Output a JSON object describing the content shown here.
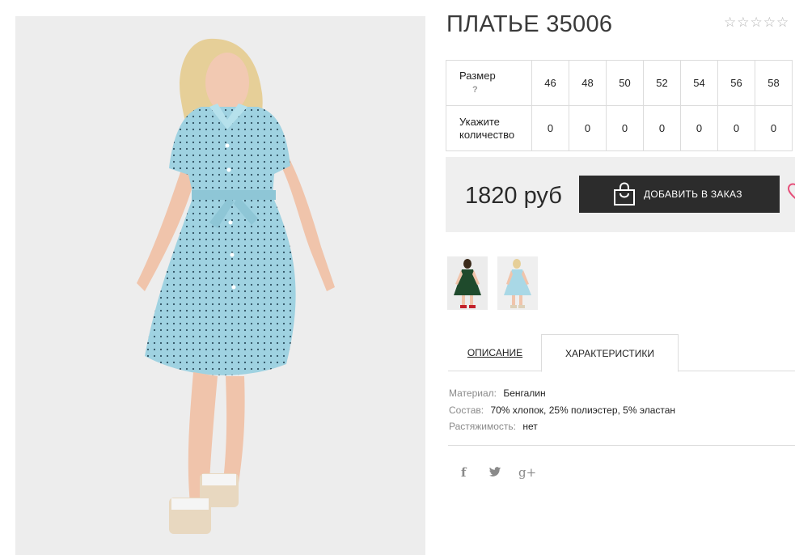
{
  "product": {
    "title": "ПЛАТЬЕ 35006",
    "rating_stars": [
      "☆",
      "☆",
      "☆",
      "☆",
      "☆"
    ]
  },
  "sizes_table": {
    "size_label": "Размер",
    "help_mark": "?",
    "qty_label": "Укажите количество",
    "sizes": [
      "46",
      "48",
      "50",
      "52",
      "54",
      "56",
      "58"
    ],
    "quantities": [
      "0",
      "0",
      "0",
      "0",
      "0",
      "0",
      "0"
    ]
  },
  "buy": {
    "price": "1820 руб",
    "add_label": "ДОБАВИТЬ В ЗАКАЗ",
    "icons": [
      "shopping-bag-icon",
      "heart-icon"
    ]
  },
  "tabs": {
    "description": "ОПИСАНИЕ",
    "characteristics": "ХАРАКТЕРИСТИКИ"
  },
  "specs": [
    {
      "key": "Материал:",
      "value": "Бенгалин"
    },
    {
      "key": "Состав:",
      "value": "70% хлопок, 25% полиэстер, 5% эластан"
    },
    {
      "key": "Растяжимость:",
      "value": "нет"
    }
  ],
  "social": {
    "facebook": "f",
    "twitter": "🐦",
    "googleplus": "g+"
  },
  "colors": {
    "dress_blue": "#9fd2e1",
    "thumb_green": "#1f4a2c",
    "button_dark": "#2c2c2c",
    "heart_pink": "#e6507a"
  }
}
